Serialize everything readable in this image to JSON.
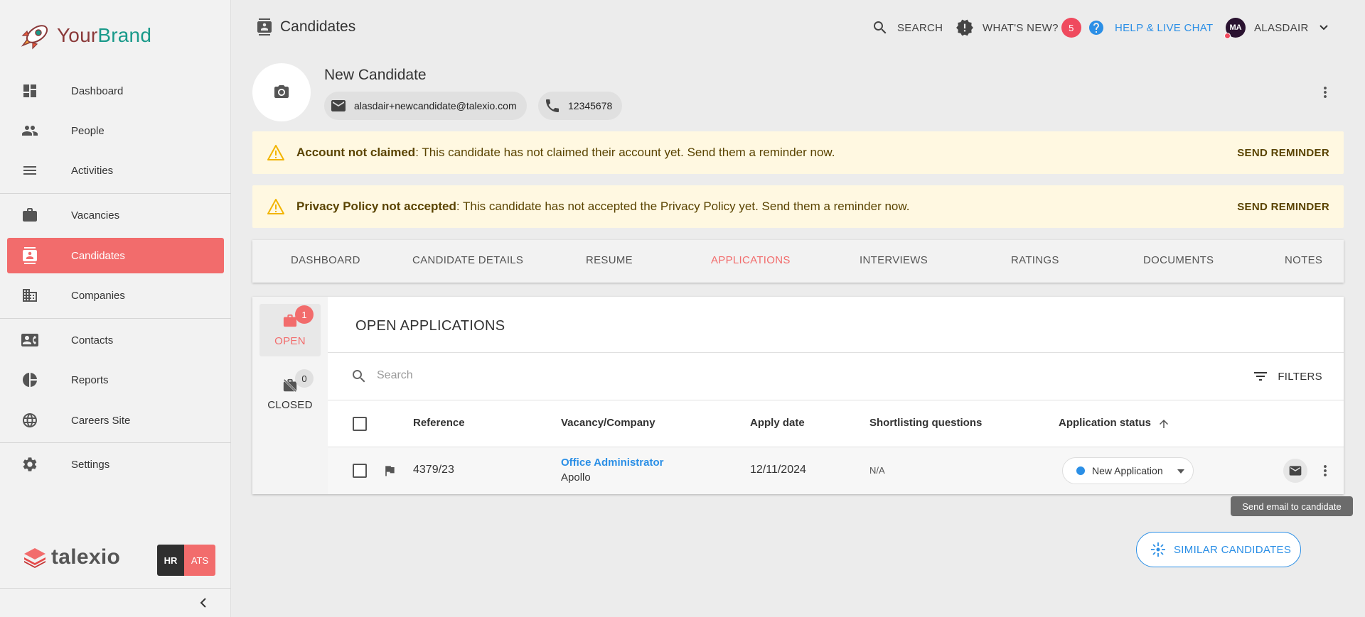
{
  "brand": {
    "name_part1": "Your",
    "name_part2": "Brand"
  },
  "sidebar": {
    "items": [
      {
        "label": "Dashboard"
      },
      {
        "label": "People"
      },
      {
        "label": "Activities"
      },
      {
        "label": "Vacancies"
      },
      {
        "label": "Candidates"
      },
      {
        "label": "Companies"
      },
      {
        "label": "Contacts"
      },
      {
        "label": "Reports"
      },
      {
        "label": "Careers Site"
      },
      {
        "label": "Settings"
      }
    ],
    "active": "Candidates",
    "footer_logo": "talexio",
    "switch": {
      "hr": "HR",
      "ats": "ATS"
    }
  },
  "header": {
    "title": "Candidates",
    "search": "SEARCH",
    "whats_new": "WHAT'S NEW?",
    "whats_new_count": "5",
    "help": "HELP & LIVE CHAT",
    "user_initials": "MA",
    "user_name": "ALASDAIR"
  },
  "candidate": {
    "name": "New Candidate",
    "email": "alasdair+newcandidate@talexio.com",
    "phone": "12345678"
  },
  "alerts": [
    {
      "bold": "Account not claimed",
      "text": ": This candidate has not claimed their account yet. Send them a reminder now.",
      "action": "SEND REMINDER"
    },
    {
      "bold": "Privacy Policy not accepted",
      "text": ": This candidate has not accepted the Privacy Policy yet. Send them a reminder now.",
      "action": "SEND REMINDER"
    }
  ],
  "tabs": [
    "DASHBOARD",
    "CANDIDATE DETAILS",
    "RESUME",
    "APPLICATIONS",
    "INTERVIEWS",
    "RATINGS",
    "DOCUMENTS",
    "NOTES"
  ],
  "active_tab": "APPLICATIONS",
  "applications": {
    "side": {
      "open_label": "OPEN",
      "open_count": "1",
      "closed_label": "CLOSED",
      "closed_count": "0"
    },
    "title": "OPEN APPLICATIONS",
    "search_placeholder": "Search",
    "filters": "FILTERS",
    "columns": [
      "Reference",
      "Vacancy/Company",
      "Apply date",
      "Shortlisting questions",
      "Application status"
    ],
    "rows": [
      {
        "reference": "4379/23",
        "vacancy": "Office Administrator",
        "company": "Apollo",
        "apply_date": "12/11/2024",
        "shortlisting": "N/A",
        "status": "New Application"
      }
    ],
    "tooltip": "Send email to candidate"
  },
  "similar_button": "SIMILAR CANDIDATES",
  "colors": {
    "accent": "#f26c6c",
    "link": "#2b8fe6",
    "alert_bg": "#fff8e1",
    "badge": "#ef4a5e"
  }
}
